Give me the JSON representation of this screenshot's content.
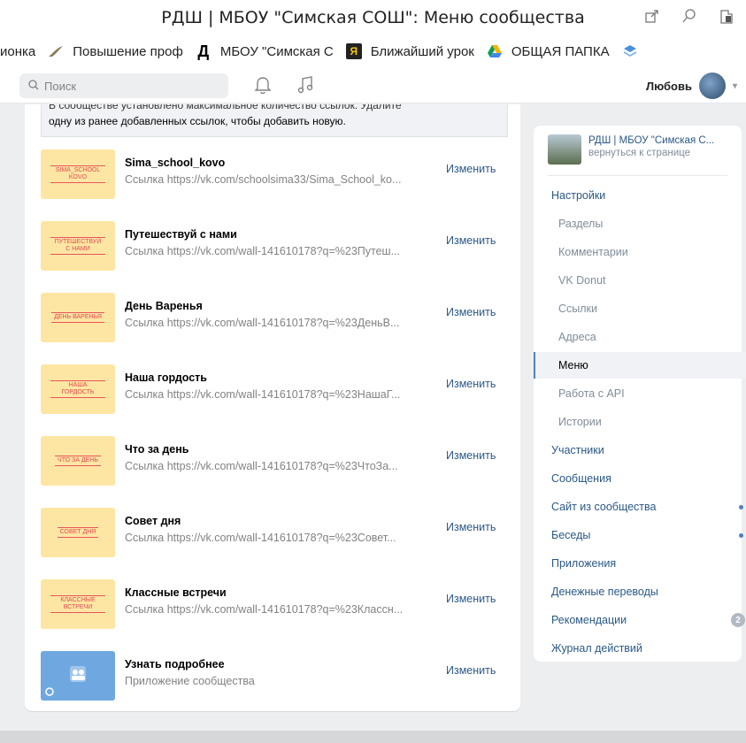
{
  "window": {
    "title": "РДШ | МБОУ \"Симская СОШ\": Меню сообщества"
  },
  "bookmarks": [
    {
      "label": "ионка",
      "icon": ""
    },
    {
      "label": "Повышение проф",
      "icon": "leaf-icon"
    },
    {
      "label": "МБОУ \"Симская С",
      "icon": "d-logo-icon"
    },
    {
      "label": "Ближайший урок",
      "icon": "ya-logo-icon"
    },
    {
      "label": "ОБЩАЯ ПАПКА",
      "icon": "google-drive-icon"
    }
  ],
  "header": {
    "search_placeholder": "Поиск",
    "user_name": "Любовь"
  },
  "notice": {
    "line1": "В сообществе установлено максимальное количество ссылок. Удалите",
    "line2": "одну из ранее добавленных ссылок, чтобы добавить новую."
  },
  "menu_items": [
    {
      "thumb_text": "SIMA_SCHOOL KOVO",
      "name": "Sima_school_kovo",
      "link": "Ссылка https://vk.com/schoolsima33/Sima_School_ko...",
      "action": "Изменить"
    },
    {
      "thumb_text": "ПУТЕШЕСТВУЙ С НАМИ",
      "name": "Путешествуй с нами",
      "link": "Ссылка https://vk.com/wall-141610178?q=%23Путеш...",
      "action": "Изменить"
    },
    {
      "thumb_text": "ДЕНЬ ВАРЕНЬЯ",
      "name": "День Варенья",
      "link": "Ссылка https://vk.com/wall-141610178?q=%23ДеньВ...",
      "action": "Изменить"
    },
    {
      "thumb_text": "НАША ГОРДОСТЬ",
      "name": "Наша гордость",
      "link": "Ссылка https://vk.com/wall-141610178?q=%23НашаГ...",
      "action": "Изменить"
    },
    {
      "thumb_text": "ЧТО ЗА ДЕНЬ",
      "name": "Что за день",
      "link": "Ссылка https://vk.com/wall-141610178?q=%23ЧтоЗа...",
      "action": "Изменить"
    },
    {
      "thumb_text": "СОВЕТ ДНЯ",
      "name": "Совет дня",
      "link": "Ссылка https://vk.com/wall-141610178?q=%23Совет...",
      "action": "Изменить"
    },
    {
      "thumb_text": "КЛАССНЫЕ ВСТРЕЧИ",
      "name": "Классные встречи",
      "link": "Ссылка https://vk.com/wall-141610178?q=%23Классн...",
      "action": "Изменить"
    },
    {
      "thumb_text": "",
      "name": "Узнать подробнее",
      "link": "Приложение сообщества",
      "action": "Изменить"
    }
  ],
  "sidebar": {
    "group_name": "РДШ | МБОУ \"Симская С...",
    "group_back": "вернуться к странице",
    "items": [
      {
        "label": "Настройки",
        "level": "top"
      },
      {
        "label": "Разделы",
        "level": "sub",
        "dot": true
      },
      {
        "label": "Комментарии",
        "level": "sub",
        "dot": true
      },
      {
        "label": "VK Donut",
        "level": "sub"
      },
      {
        "label": "Ссылки",
        "level": "sub"
      },
      {
        "label": "Адреса",
        "level": "sub"
      },
      {
        "label": "Меню",
        "level": "sub",
        "active": true
      },
      {
        "label": "Работа с API",
        "level": "sub"
      },
      {
        "label": "Истории",
        "level": "sub"
      },
      {
        "label": "Участники",
        "level": "top"
      },
      {
        "label": "Сообщения",
        "level": "top"
      },
      {
        "label": "Сайт из сообщества",
        "level": "top",
        "dot": true
      },
      {
        "label": "Беседы",
        "level": "top",
        "dot": true
      },
      {
        "label": "Приложения",
        "level": "top"
      },
      {
        "label": "Денежные переводы",
        "level": "top"
      },
      {
        "label": "Рекомендации",
        "level": "top",
        "badge": "2"
      },
      {
        "label": "Журнал действий",
        "level": "top"
      }
    ]
  },
  "colors": {
    "link": "#2a5885",
    "muted": "#828282",
    "accent": "#5181b8",
    "thumb_bg": "#fde6a3",
    "thumb_text": "#e24b52"
  }
}
